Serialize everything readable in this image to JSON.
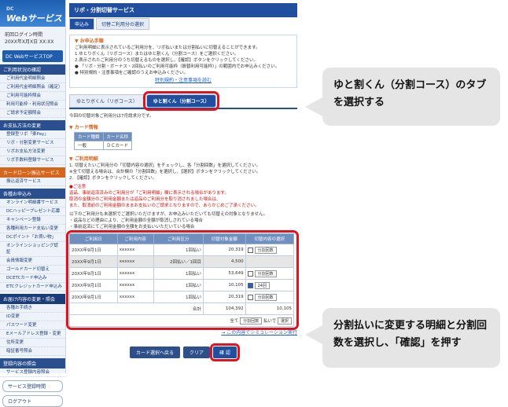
{
  "sidebar": {
    "logo": "Webサービス",
    "logo_sub": "DC",
    "last_login_label": "前回ログイン時間",
    "last_login_value": "20XX年X月X日 XX:XX",
    "top_button": "DC WebサービスTOP",
    "sections": [
      {
        "title": "ご利用状況の確認",
        "items": [
          "ご利用代金明細照会",
          "ご利用代金明細照会（確定）",
          "ご利用可能枠照会",
          "利用可能枠・利用状況照会",
          "ご請求予定額照会"
        ]
      },
      {
        "title": "お支払方法の変更",
        "items": [
          "登録型リボ「楽Pay」",
          "リボ・分割変更サービス",
          "リボお支払方法変更",
          "リボ手数料登録サービス"
        ]
      },
      {
        "title": "カードローン振込サービス",
        "items": [
          "振込返済サービス"
        ]
      },
      {
        "title": "各種お申込み",
        "items": [
          "オンライン明細書サービス",
          "DCハッピープレゼント応募",
          "キャンペーン登録",
          "各種利用カード支払い変更",
          "DCポイント「お買い物」",
          "オンラインショッピング認証",
          "会員情報変更",
          "ゴールドカード切替え",
          "DCETCカード申込み",
          "ETCクレジットカード申込み"
        ]
      },
      {
        "title": "お届け内容の変更・照会",
        "items": [
          "各種お手続き",
          "ID変更",
          "パスワード変更",
          "Eメールアドレス登録・変更",
          "住所変更",
          "暗証番号照会"
        ]
      },
      {
        "title": "登録内容の照会",
        "items": [
          "サービス登録内容照会"
        ]
      }
    ],
    "bottom_buttons": [
      "サービス登録時間",
      "ログアウト"
    ]
  },
  "main": {
    "header": "リボ・分割切替サービス",
    "subtabs": [
      "申込み",
      "切替ご利用分の選択"
    ],
    "procedure_title": "▼ お申込手順",
    "procedure_lines": [
      "ご利用明細に表示されているご利用分を、リボ払いまたは分割払いに切替えることができます。",
      "1.ゆとりボくん（リボコース）またはゆと割くん（分割コース）をご選択ください。",
      "2.表示されたご利用分のうち切替えるものを選択し、【確認】ボタンをクリックしてください。",
      "● 「リボ・分割・ボーナス・2回払いのご利用可能枠（振替利用可能枠）」の範囲内でお申込みください。",
      "● 特別規約・注意事項をご確認のうえお申込みください。"
    ],
    "terms_link": "特別規約・注意事項を読む",
    "tabs": [
      "ゆとりボくん（リボコース）",
      "ゆと割くん（分割コース）"
    ],
    "target_month_text": "今回の切替対象ご利用分は7月請求分です。",
    "card_section_title": "▼ カード情報",
    "card_table_headers": [
      "カード種類",
      "カード名称"
    ],
    "card_table_row": [
      "一般",
      "ＤＣカード"
    ],
    "usage_section_title": "▼ ご利用明細",
    "usage_lines": [
      "1. 切替えたいご利用分の「切替内容の選択」をチェックし、各「分割回数」を選択してください。",
      "※全て切替える場合は、合計欄の「分割回数」を選択し、【選択】ボタンをクリックしてください。",
      "2. 【確認】ボタンをクリックしてください。"
    ],
    "note_title": "●ご注意",
    "note_lines": [
      "返品、事前返済済みのご利用分が「ご利用明細」欄に表示される場合があります。",
      "取消の金額分のご利用金額または返品のご利用分を取り消されました場合は、",
      "また、取消前のご利用金額のままお支払いのご請求となりますので、あらかじめご了承ください。"
    ],
    "note_lines2": [
      "以下のご利用分も未選択でご選択いただけますが、お申込みいただいても切替えの対象となりません。",
      "・返品などの理由により、ご利用金額の全額が取消しされている場合",
      "・事前返済にてご利用金額の全額をお支払いいただいている場合"
    ],
    "detail_headers": [
      "ご利用日",
      "ご利用内容",
      "ご利用区分",
      "切替対象金額",
      "切替内容の選択"
    ],
    "detail_rows": [
      {
        "date": "20XX年9月1日",
        "content": "xxxxxx",
        "type": "1回払い",
        "amount": "20,319",
        "checked": false,
        "select": "分割回数"
      },
      {
        "date": "20XX年9月1日",
        "content": "xxxxxx",
        "type": "2回払い／1回目",
        "amount": "4,500",
        "checked": false,
        "select": ""
      },
      {
        "date": "20XX年9月1日",
        "content": "xxxxxx",
        "type": "1回払い",
        "amount": "53,649",
        "checked": false,
        "select": "分割回数"
      },
      {
        "date": "20XX年9月1日",
        "content": "xxxxxx",
        "type": "1回払い",
        "amount": "10,105",
        "checked": true,
        "select": "24回"
      },
      {
        "date": "20XX年9月1日",
        "content": "xxxxxx",
        "type": "1回払い",
        "amount": "20,319",
        "checked": false,
        "select": "分割回数"
      }
    ],
    "total_label": "合計",
    "total_amount": "104,392",
    "total_selected": "10,105",
    "bulk_prefix": "全て",
    "bulk_select": "分割回数",
    "bulk_suffix": "払いで",
    "bulk_button": "選択",
    "simulation_link": "→ この内容でシミュレーション実行",
    "buttons": [
      "カード選択へ戻る",
      "クリア",
      "確 認"
    ]
  },
  "callouts": [
    "ゆと割くん（分割コース）のタブを選択する",
    "分割払いに変更する明細と分割回数を選択し、「確認」を押す"
  ]
}
